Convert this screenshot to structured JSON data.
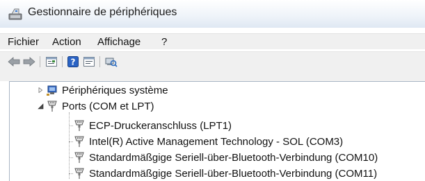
{
  "window": {
    "title": "Gestionnaire de périphériques"
  },
  "menu": {
    "items": [
      {
        "label": "Fichier"
      },
      {
        "label": "Action"
      },
      {
        "label": "Affichage"
      },
      {
        "label": "?"
      }
    ]
  },
  "toolbar": {
    "buttons": [
      "back-arrow-icon",
      "forward-arrow-icon",
      "properties-icon",
      "help-icon",
      "show-hidden-icon",
      "scan-hardware-icon"
    ]
  },
  "tree": {
    "nodes": [
      {
        "label": "Périphériques système",
        "expanded": false,
        "icon": "system-devices-icon"
      },
      {
        "label": "Ports (COM et LPT)",
        "expanded": true,
        "icon": "port-connector-icon",
        "children": [
          {
            "label": "ECP-Druckeranschluss (LPT1)",
            "icon": "port-connector-icon"
          },
          {
            "label": "Intel(R) Active Management Technology - SOL (COM3)",
            "icon": "port-connector-icon"
          },
          {
            "label": "Standardmäßgige Seriell-über-Bluetooth-Verbindung (COM10)",
            "icon": "port-connector-icon"
          },
          {
            "label": "Standardmäßgige Seriell-über-Bluetooth-Verbindung (COM11)",
            "icon": "port-connector-icon"
          }
        ]
      }
    ]
  },
  "colors": {
    "toolbar_bg": "#f0f0f0",
    "title_gradient_end": "#dfe8f3",
    "tree_border": "#a9b5c4"
  }
}
